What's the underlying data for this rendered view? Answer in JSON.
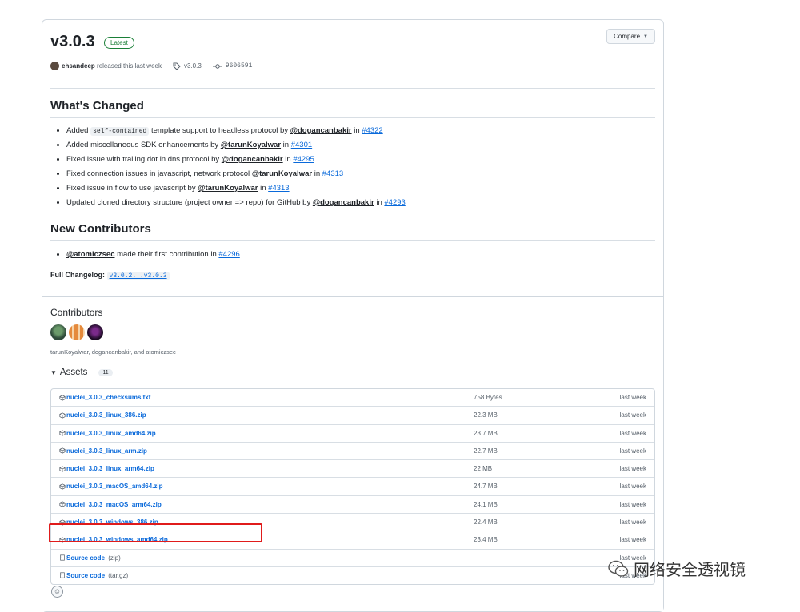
{
  "release": {
    "title": "v3.0.3",
    "badge": "Latest",
    "compare_label": "Compare",
    "author": "ehsandeep",
    "released_text": "released this last week",
    "tag": "v3.0.3",
    "commit": "9606591"
  },
  "whats_changed": {
    "heading": "What's Changed",
    "items": [
      {
        "pre": "Added ",
        "code": "self-contained",
        "text": " template support to headless protocol by ",
        "user": "@dogancanbakir",
        "in": " in ",
        "pr": "#4322"
      },
      {
        "pre": "",
        "code": "",
        "text": "Added miscellaneous SDK enhancements by ",
        "user": "@tarunKoyalwar",
        "in": " in ",
        "pr": "#4301"
      },
      {
        "pre": "",
        "code": "",
        "text": "Fixed issue with trailing dot in dns protocol by ",
        "user": "@dogancanbakir",
        "in": " in ",
        "pr": "#4295"
      },
      {
        "pre": "",
        "code": "",
        "text": "Fixed connection issues in javascript, network protocol ",
        "user": "@tarunKoyalwar",
        "in": " in ",
        "pr": "#4313"
      },
      {
        "pre": "",
        "code": "",
        "text": "Fixed issue in flow to use javascript by ",
        "user": "@tarunKoyalwar",
        "in": " in ",
        "pr": "#4313"
      },
      {
        "pre": "",
        "code": "",
        "text": "Updated cloned directory structure (project owner => repo) for GitHub by ",
        "user": "@dogancanbakir",
        "in": " in ",
        "pr": "#4293"
      }
    ]
  },
  "new_contributors": {
    "heading": "New Contributors",
    "items": [
      {
        "user": "@atomiczsec",
        "text": " made their first contribution in ",
        "pr": "#4296"
      }
    ]
  },
  "changelog": {
    "label": "Full Changelog:",
    "range": "v3.0.2...v3.0.3"
  },
  "contributors": {
    "heading": "Contributors",
    "names": "tarunKoyalwar, dogancanbakir, and atomiczsec"
  },
  "assets": {
    "heading": "Assets",
    "count": "11",
    "files": [
      {
        "name": "nuclei_3.0.3_checksums.txt",
        "size": "758 Bytes",
        "date": "last week"
      },
      {
        "name": "nuclei_3.0.3_linux_386.zip",
        "size": "22.3 MB",
        "date": "last week"
      },
      {
        "name": "nuclei_3.0.3_linux_amd64.zip",
        "size": "23.7 MB",
        "date": "last week"
      },
      {
        "name": "nuclei_3.0.3_linux_arm.zip",
        "size": "22.7 MB",
        "date": "last week"
      },
      {
        "name": "nuclei_3.0.3_linux_arm64.zip",
        "size": "22 MB",
        "date": "last week"
      },
      {
        "name": "nuclei_3.0.3_macOS_amd64.zip",
        "size": "24.7 MB",
        "date": "last week"
      },
      {
        "name": "nuclei_3.0.3_macOS_arm64.zip",
        "size": "24.1 MB",
        "date": "last week"
      },
      {
        "name": "nuclei_3.0.3_windows_386.zip",
        "size": "22.4 MB",
        "date": "last week"
      },
      {
        "name": "nuclei_3.0.3_windows_amd64.zip",
        "size": "23.4 MB",
        "date": "last week"
      }
    ],
    "sources": [
      {
        "name": "Source code",
        "ext": "(zip)",
        "date": "last week"
      },
      {
        "name": "Source code",
        "ext": "(tar.gz)",
        "date": "last week"
      }
    ]
  },
  "watermark": {
    "text": "网络安全透视镜"
  },
  "colors": {
    "link": "#0969da",
    "latest": "#1a7f37",
    "highlight": "#e01b1b"
  }
}
